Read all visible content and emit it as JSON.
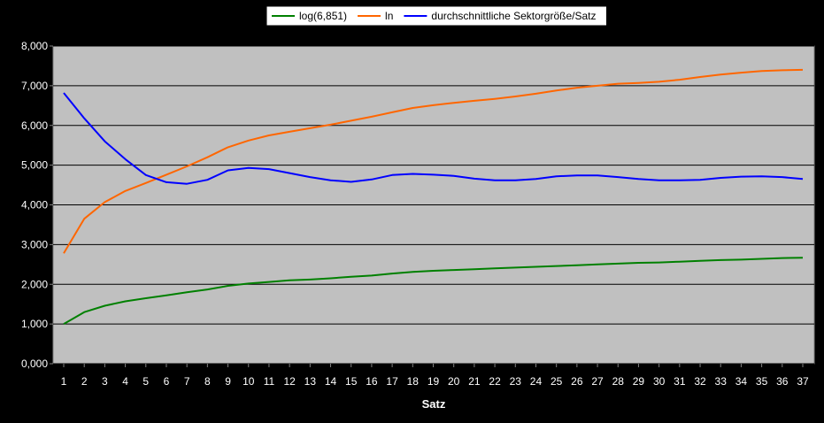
{
  "chart_data": {
    "type": "line",
    "title": "",
    "xlabel": "Satz",
    "ylabel": "",
    "x": [
      1,
      2,
      3,
      4,
      5,
      6,
      7,
      8,
      9,
      10,
      11,
      12,
      13,
      14,
      15,
      16,
      17,
      18,
      19,
      20,
      21,
      22,
      23,
      24,
      25,
      26,
      27,
      28,
      29,
      30,
      31,
      32,
      33,
      34,
      35,
      36,
      37
    ],
    "ylim": [
      0,
      8
    ],
    "yticks": [
      0,
      1,
      2,
      3,
      4,
      5,
      6,
      7,
      8
    ],
    "ytick_labels": [
      "0,000",
      "1,000",
      "2,000",
      "3,000",
      "4,000",
      "5,000",
      "6,000",
      "7,000",
      "8,000"
    ],
    "grid": true,
    "legend": "top-center",
    "plot_background": "#c0c0c0",
    "series": [
      {
        "name": "log(6,851)",
        "color": "#008000",
        "values": [
          1.0,
          1.3,
          1.46,
          1.57,
          1.65,
          1.72,
          1.8,
          1.87,
          1.96,
          2.02,
          2.06,
          2.1,
          2.12,
          2.15,
          2.19,
          2.22,
          2.27,
          2.31,
          2.34,
          2.36,
          2.38,
          2.4,
          2.42,
          2.44,
          2.46,
          2.48,
          2.5,
          2.52,
          2.54,
          2.55,
          2.57,
          2.59,
          2.61,
          2.62,
          2.64,
          2.66,
          2.67
        ]
      },
      {
        "name": "ln",
        "color": "#ff6600",
        "values": [
          2.78,
          3.65,
          4.07,
          4.35,
          4.55,
          4.76,
          4.97,
          5.2,
          5.45,
          5.62,
          5.75,
          5.84,
          5.93,
          6.02,
          6.12,
          6.22,
          6.33,
          6.44,
          6.51,
          6.57,
          6.62,
          6.67,
          6.73,
          6.8,
          6.88,
          6.95,
          7.0,
          7.05,
          7.07,
          7.1,
          7.15,
          7.22,
          7.28,
          7.33,
          7.37,
          7.39,
          7.4
        ]
      },
      {
        "name": "durchschnittliche Sektorgröße/Satz",
        "color": "#0000ff",
        "values": [
          6.82,
          6.18,
          5.6,
          5.15,
          4.75,
          4.57,
          4.53,
          4.63,
          4.87,
          4.93,
          4.9,
          4.8,
          4.7,
          4.62,
          4.58,
          4.64,
          4.75,
          4.78,
          4.76,
          4.73,
          4.66,
          4.62,
          4.62,
          4.65,
          4.72,
          4.74,
          4.74,
          4.7,
          4.65,
          4.62,
          4.62,
          4.63,
          4.68,
          4.71,
          4.72,
          4.7,
          4.65
        ]
      }
    ]
  }
}
